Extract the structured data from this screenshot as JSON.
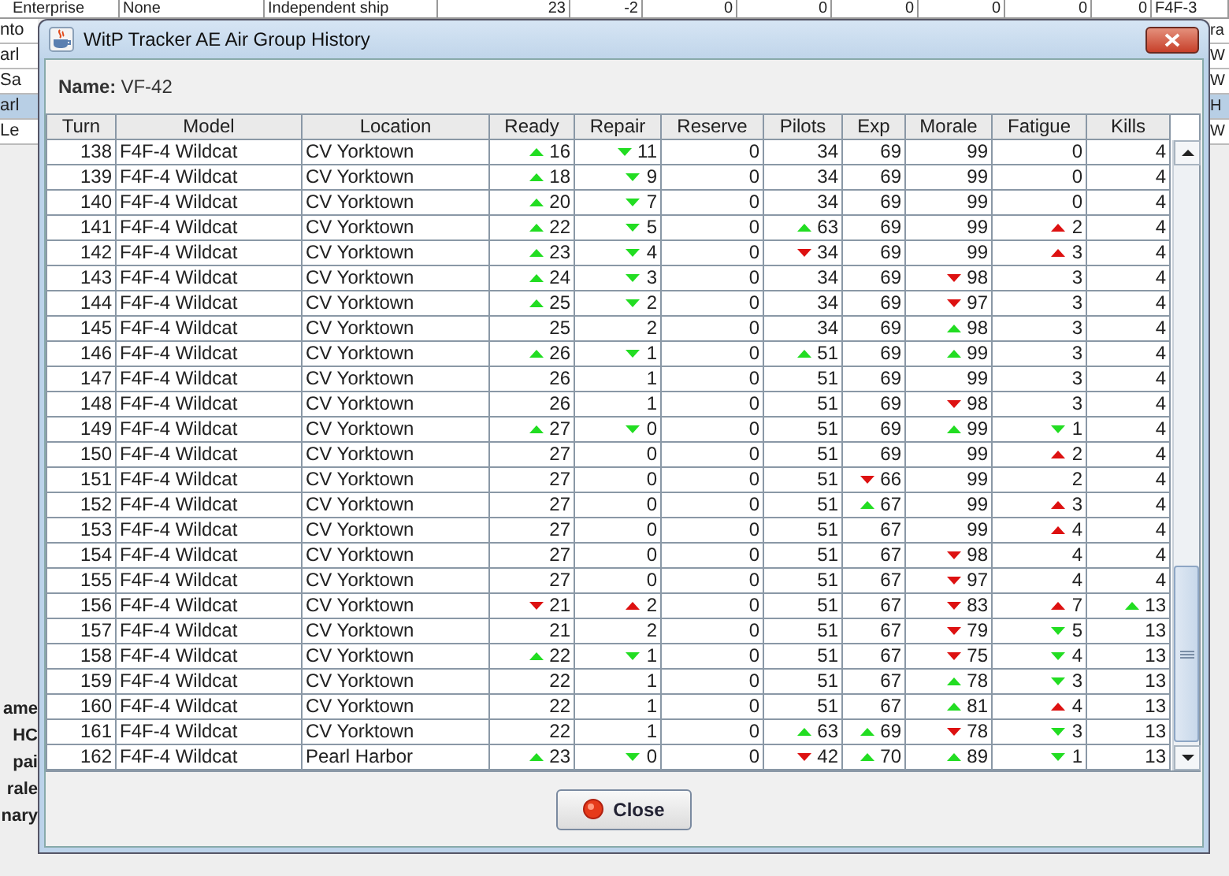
{
  "background": {
    "top_row": [
      "Enterprise",
      "None",
      "Independent ship",
      "23",
      "-2",
      "0",
      "0",
      "0",
      "0",
      "0",
      "0",
      "F4F-3"
    ],
    "left_rows": [
      {
        "text": "nto",
        "selected": false
      },
      {
        "text": "arl",
        "selected": false
      },
      {
        "text": "Sa",
        "selected": false
      },
      {
        "text": "arl",
        "selected": true
      },
      {
        "text": "Le",
        "selected": false
      }
    ],
    "right_rows": [
      {
        "text": "ra",
        "selected": false
      },
      {
        "text": "W",
        "selected": false
      },
      {
        "text": "W",
        "selected": false
      },
      {
        "text": "H",
        "selected": true
      },
      {
        "text": "W",
        "selected": false
      }
    ],
    "left_labels": [
      "ame",
      "HC",
      "pai",
      "rale",
      "nary"
    ]
  },
  "window": {
    "title": "WitP Tracker AE Air Group History"
  },
  "name_label": "Name:",
  "name_value": "VF-42",
  "table": {
    "columns": [
      "Turn",
      "Model",
      "Location",
      "Ready",
      "Repair",
      "Reserve",
      "Pilots",
      "Exp",
      "Morale",
      "Fatigue",
      "Kills"
    ],
    "rows": [
      {
        "turn": "138",
        "model": "F4F-4 Wildcat",
        "location": "CV Yorktown",
        "cells": [
          {
            "text": "16",
            "kind": "rise",
            "color": "#22dd22"
          },
          {
            "text": "11",
            "kind": "fall",
            "color": "#22dd22"
          },
          {
            "text": "0"
          },
          {
            "text": "34"
          },
          {
            "text": "69"
          },
          {
            "text": "99"
          },
          {
            "text": "0"
          },
          {
            "text": "4"
          }
        ]
      },
      {
        "turn": "139",
        "model": "F4F-4 Wildcat",
        "location": "CV Yorktown",
        "cells": [
          {
            "text": "18",
            "kind": "rise",
            "color": "#22dd22"
          },
          {
            "text": "9",
            "kind": "fall",
            "color": "#22dd22"
          },
          {
            "text": "0"
          },
          {
            "text": "34"
          },
          {
            "text": "69"
          },
          {
            "text": "99"
          },
          {
            "text": "0"
          },
          {
            "text": "4"
          }
        ]
      },
      {
        "turn": "140",
        "model": "F4F-4 Wildcat",
        "location": "CV Yorktown",
        "cells": [
          {
            "text": "20",
            "kind": "rise",
            "color": "#22dd22"
          },
          {
            "text": "7",
            "kind": "fall",
            "color": "#22dd22"
          },
          {
            "text": "0"
          },
          {
            "text": "34"
          },
          {
            "text": "69"
          },
          {
            "text": "99"
          },
          {
            "text": "0"
          },
          {
            "text": "4"
          }
        ]
      },
      {
        "turn": "141",
        "model": "F4F-4 Wildcat",
        "location": "CV Yorktown",
        "cells": [
          {
            "text": "22",
            "kind": "rise",
            "color": "#22dd22"
          },
          {
            "text": "5",
            "kind": "fall",
            "color": "#22dd22"
          },
          {
            "text": "0"
          },
          {
            "text": "63",
            "kind": "rise",
            "color": "#22dd22"
          },
          {
            "text": "69"
          },
          {
            "text": "99"
          },
          {
            "text": "2",
            "kind": "rise",
            "color": "#dd1111"
          },
          {
            "text": "4"
          }
        ]
      },
      {
        "turn": "142",
        "model": "F4F-4 Wildcat",
        "location": "CV Yorktown",
        "cells": [
          {
            "text": "23",
            "kind": "rise",
            "color": "#22dd22"
          },
          {
            "text": "4",
            "kind": "fall",
            "color": "#22dd22"
          },
          {
            "text": "0"
          },
          {
            "text": "34",
            "kind": "fall",
            "color": "#dd1111"
          },
          {
            "text": "69"
          },
          {
            "text": "99"
          },
          {
            "text": "3",
            "kind": "rise",
            "color": "#dd1111"
          },
          {
            "text": "4"
          }
        ]
      },
      {
        "turn": "143",
        "model": "F4F-4 Wildcat",
        "location": "CV Yorktown",
        "cells": [
          {
            "text": "24",
            "kind": "rise",
            "color": "#22dd22"
          },
          {
            "text": "3",
            "kind": "fall",
            "color": "#22dd22"
          },
          {
            "text": "0"
          },
          {
            "text": "34"
          },
          {
            "text": "69"
          },
          {
            "text": "98",
            "kind": "fall",
            "color": "#dd1111"
          },
          {
            "text": "3"
          },
          {
            "text": "4"
          }
        ]
      },
      {
        "turn": "144",
        "model": "F4F-4 Wildcat",
        "location": "CV Yorktown",
        "cells": [
          {
            "text": "25",
            "kind": "rise",
            "color": "#22dd22"
          },
          {
            "text": "2",
            "kind": "fall",
            "color": "#22dd22"
          },
          {
            "text": "0"
          },
          {
            "text": "34"
          },
          {
            "text": "69"
          },
          {
            "text": "97",
            "kind": "fall",
            "color": "#dd1111"
          },
          {
            "text": "3"
          },
          {
            "text": "4"
          }
        ]
      },
      {
        "turn": "145",
        "model": "F4F-4 Wildcat",
        "location": "CV Yorktown",
        "cells": [
          {
            "text": "25"
          },
          {
            "text": "2"
          },
          {
            "text": "0"
          },
          {
            "text": "34"
          },
          {
            "text": "69"
          },
          {
            "text": "98",
            "kind": "rise",
            "color": "#22dd22"
          },
          {
            "text": "3"
          },
          {
            "text": "4"
          }
        ]
      },
      {
        "turn": "146",
        "model": "F4F-4 Wildcat",
        "location": "CV Yorktown",
        "cells": [
          {
            "text": "26",
            "kind": "rise",
            "color": "#22dd22"
          },
          {
            "text": "1",
            "kind": "fall",
            "color": "#22dd22"
          },
          {
            "text": "0"
          },
          {
            "text": "51",
            "kind": "rise",
            "color": "#22dd22"
          },
          {
            "text": "69"
          },
          {
            "text": "99",
            "kind": "rise",
            "color": "#22dd22"
          },
          {
            "text": "3"
          },
          {
            "text": "4"
          }
        ]
      },
      {
        "turn": "147",
        "model": "F4F-4 Wildcat",
        "location": "CV Yorktown",
        "cells": [
          {
            "text": "26"
          },
          {
            "text": "1"
          },
          {
            "text": "0"
          },
          {
            "text": "51"
          },
          {
            "text": "69"
          },
          {
            "text": "99"
          },
          {
            "text": "3"
          },
          {
            "text": "4"
          }
        ]
      },
      {
        "turn": "148",
        "model": "F4F-4 Wildcat",
        "location": "CV Yorktown",
        "cells": [
          {
            "text": "26"
          },
          {
            "text": "1"
          },
          {
            "text": "0"
          },
          {
            "text": "51"
          },
          {
            "text": "69"
          },
          {
            "text": "98",
            "kind": "fall",
            "color": "#dd1111"
          },
          {
            "text": "3"
          },
          {
            "text": "4"
          }
        ]
      },
      {
        "turn": "149",
        "model": "F4F-4 Wildcat",
        "location": "CV Yorktown",
        "cells": [
          {
            "text": "27",
            "kind": "rise",
            "color": "#22dd22"
          },
          {
            "text": "0",
            "kind": "fall",
            "color": "#22dd22"
          },
          {
            "text": "0"
          },
          {
            "text": "51"
          },
          {
            "text": "69"
          },
          {
            "text": "99",
            "kind": "rise",
            "color": "#22dd22"
          },
          {
            "text": "1",
            "kind": "fall",
            "color": "#22dd22"
          },
          {
            "text": "4"
          }
        ]
      },
      {
        "turn": "150",
        "model": "F4F-4 Wildcat",
        "location": "CV Yorktown",
        "cells": [
          {
            "text": "27"
          },
          {
            "text": "0"
          },
          {
            "text": "0"
          },
          {
            "text": "51"
          },
          {
            "text": "69"
          },
          {
            "text": "99"
          },
          {
            "text": "2",
            "kind": "rise",
            "color": "#dd1111"
          },
          {
            "text": "4"
          }
        ]
      },
      {
        "turn": "151",
        "model": "F4F-4 Wildcat",
        "location": "CV Yorktown",
        "cells": [
          {
            "text": "27"
          },
          {
            "text": "0"
          },
          {
            "text": "0"
          },
          {
            "text": "51"
          },
          {
            "text": "66",
            "kind": "fall",
            "color": "#dd1111"
          },
          {
            "text": "99"
          },
          {
            "text": "2"
          },
          {
            "text": "4"
          }
        ]
      },
      {
        "turn": "152",
        "model": "F4F-4 Wildcat",
        "location": "CV Yorktown",
        "cells": [
          {
            "text": "27"
          },
          {
            "text": "0"
          },
          {
            "text": "0"
          },
          {
            "text": "51"
          },
          {
            "text": "67",
            "kind": "rise",
            "color": "#22dd22"
          },
          {
            "text": "99"
          },
          {
            "text": "3",
            "kind": "rise",
            "color": "#dd1111"
          },
          {
            "text": "4"
          }
        ]
      },
      {
        "turn": "153",
        "model": "F4F-4 Wildcat",
        "location": "CV Yorktown",
        "cells": [
          {
            "text": "27"
          },
          {
            "text": "0"
          },
          {
            "text": "0"
          },
          {
            "text": "51"
          },
          {
            "text": "67"
          },
          {
            "text": "99"
          },
          {
            "text": "4",
            "kind": "rise",
            "color": "#dd1111"
          },
          {
            "text": "4"
          }
        ]
      },
      {
        "turn": "154",
        "model": "F4F-4 Wildcat",
        "location": "CV Yorktown",
        "cells": [
          {
            "text": "27"
          },
          {
            "text": "0"
          },
          {
            "text": "0"
          },
          {
            "text": "51"
          },
          {
            "text": "67"
          },
          {
            "text": "98",
            "kind": "fall",
            "color": "#dd1111"
          },
          {
            "text": "4"
          },
          {
            "text": "4"
          }
        ]
      },
      {
        "turn": "155",
        "model": "F4F-4 Wildcat",
        "location": "CV Yorktown",
        "cells": [
          {
            "text": "27"
          },
          {
            "text": "0"
          },
          {
            "text": "0"
          },
          {
            "text": "51"
          },
          {
            "text": "67"
          },
          {
            "text": "97",
            "kind": "fall",
            "color": "#dd1111"
          },
          {
            "text": "4"
          },
          {
            "text": "4"
          }
        ]
      },
      {
        "turn": "156",
        "model": "F4F-4 Wildcat",
        "location": "CV Yorktown",
        "cells": [
          {
            "text": "21",
            "kind": "fall",
            "color": "#dd1111"
          },
          {
            "text": "2",
            "kind": "rise",
            "color": "#dd1111"
          },
          {
            "text": "0"
          },
          {
            "text": "51"
          },
          {
            "text": "67"
          },
          {
            "text": "83",
            "kind": "fall",
            "color": "#dd1111"
          },
          {
            "text": "7",
            "kind": "rise",
            "color": "#dd1111"
          },
          {
            "text": "13",
            "kind": "rise",
            "color": "#22dd22"
          }
        ]
      },
      {
        "turn": "157",
        "model": "F4F-4 Wildcat",
        "location": "CV Yorktown",
        "cells": [
          {
            "text": "21"
          },
          {
            "text": "2"
          },
          {
            "text": "0"
          },
          {
            "text": "51"
          },
          {
            "text": "67"
          },
          {
            "text": "79",
            "kind": "fall",
            "color": "#dd1111"
          },
          {
            "text": "5",
            "kind": "fall",
            "color": "#22dd22"
          },
          {
            "text": "13"
          }
        ]
      },
      {
        "turn": "158",
        "model": "F4F-4 Wildcat",
        "location": "CV Yorktown",
        "cells": [
          {
            "text": "22",
            "kind": "rise",
            "color": "#22dd22"
          },
          {
            "text": "1",
            "kind": "fall",
            "color": "#22dd22"
          },
          {
            "text": "0"
          },
          {
            "text": "51"
          },
          {
            "text": "67"
          },
          {
            "text": "75",
            "kind": "fall",
            "color": "#dd1111"
          },
          {
            "text": "4",
            "kind": "fall",
            "color": "#22dd22"
          },
          {
            "text": "13"
          }
        ]
      },
      {
        "turn": "159",
        "model": "F4F-4 Wildcat",
        "location": "CV Yorktown",
        "cells": [
          {
            "text": "22"
          },
          {
            "text": "1"
          },
          {
            "text": "0"
          },
          {
            "text": "51"
          },
          {
            "text": "67"
          },
          {
            "text": "78",
            "kind": "rise",
            "color": "#22dd22"
          },
          {
            "text": "3",
            "kind": "fall",
            "color": "#22dd22"
          },
          {
            "text": "13"
          }
        ]
      },
      {
        "turn": "160",
        "model": "F4F-4 Wildcat",
        "location": "CV Yorktown",
        "cells": [
          {
            "text": "22"
          },
          {
            "text": "1"
          },
          {
            "text": "0"
          },
          {
            "text": "51"
          },
          {
            "text": "67"
          },
          {
            "text": "81",
            "kind": "rise",
            "color": "#22dd22"
          },
          {
            "text": "4",
            "kind": "rise",
            "color": "#dd1111"
          },
          {
            "text": "13"
          }
        ]
      },
      {
        "turn": "161",
        "model": "F4F-4 Wildcat",
        "location": "CV Yorktown",
        "cells": [
          {
            "text": "22"
          },
          {
            "text": "1"
          },
          {
            "text": "0"
          },
          {
            "text": "63",
            "kind": "rise",
            "color": "#22dd22"
          },
          {
            "text": "69",
            "kind": "rise",
            "color": "#22dd22"
          },
          {
            "text": "78",
            "kind": "fall",
            "color": "#dd1111"
          },
          {
            "text": "3",
            "kind": "fall",
            "color": "#22dd22"
          },
          {
            "text": "13"
          }
        ]
      },
      {
        "turn": "162",
        "model": "F4F-4 Wildcat",
        "location": "Pearl Harbor",
        "cells": [
          {
            "text": "23",
            "kind": "rise",
            "color": "#22dd22"
          },
          {
            "text": "0",
            "kind": "fall",
            "color": "#22dd22"
          },
          {
            "text": "0"
          },
          {
            "text": "42",
            "kind": "fall",
            "color": "#dd1111"
          },
          {
            "text": "70",
            "kind": "rise",
            "color": "#22dd22"
          },
          {
            "text": "89",
            "kind": "rise",
            "color": "#22dd22"
          },
          {
            "text": "1",
            "kind": "fall",
            "color": "#22dd22"
          },
          {
            "text": "13"
          }
        ]
      }
    ]
  },
  "close_button": "Close"
}
